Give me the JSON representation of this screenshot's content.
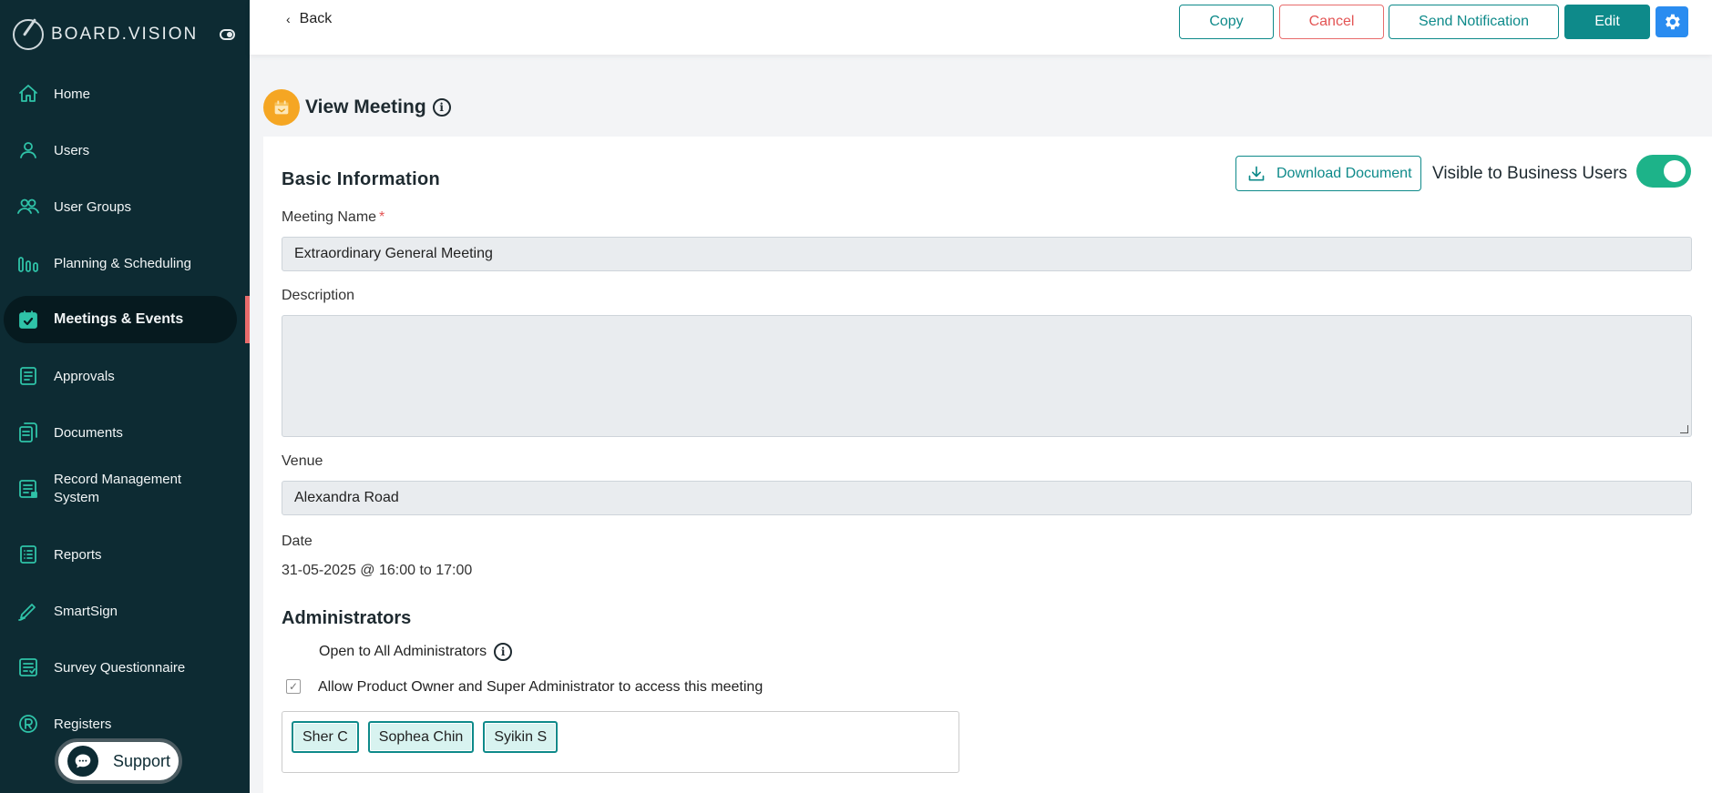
{
  "app": {
    "logo_text": "BOARD.VISION"
  },
  "sidebar": {
    "items": [
      {
        "label": "Home",
        "icon": "home-icon"
      },
      {
        "label": "Users",
        "icon": "user-icon"
      },
      {
        "label": "User Groups",
        "icon": "users-icon"
      },
      {
        "label": "Planning & Scheduling",
        "icon": "bars-icon"
      },
      {
        "label": "Meetings & Events",
        "icon": "calendar-check-icon",
        "active": true
      },
      {
        "label": "Approvals",
        "icon": "document-list-icon"
      },
      {
        "label": "Documents",
        "icon": "documents-icon"
      },
      {
        "label": "Record Management System",
        "icon": "record-icon"
      },
      {
        "label": "Reports",
        "icon": "report-icon"
      },
      {
        "label": "SmartSign",
        "icon": "pen-icon"
      },
      {
        "label": "Survey Questionnaire",
        "icon": "survey-icon"
      },
      {
        "label": "Registers",
        "icon": "registered-icon"
      }
    ],
    "support_label": "Support"
  },
  "header": {
    "back_label": "Back",
    "copy_label": "Copy",
    "cancel_label": "Cancel",
    "notify_label": "Send Notification",
    "edit_label": "Edit"
  },
  "page": {
    "title": "View Meeting"
  },
  "basic": {
    "section_title": "Basic Information",
    "download_label": "Download Document",
    "visible_label": "Visible to Business Users",
    "visible_on": true,
    "meeting_name_label": "Meeting Name",
    "meeting_name_required": "*",
    "meeting_name_value": "Extraordinary General Meeting",
    "description_label": "Description",
    "description_value": "",
    "venue_label": "Venue",
    "venue_value": "Alexandra Road",
    "date_label": "Date",
    "date_value": "31-05-2025 @ 16:00 to 17:00"
  },
  "administrators": {
    "title": "Administrators",
    "open_all_label": "Open to All Administrators",
    "allow_label": "Allow Product Owner and Super Administrator to access this meeting",
    "chips": [
      "Sher C",
      "Sophea Chin",
      "Syikin S"
    ]
  },
  "colors": {
    "sidebar_bg": "#0d2b33",
    "accent_teal": "#0e8a8a",
    "cancel_red": "#e35454",
    "gear_blue": "#2a8cf0",
    "toggle_green": "#1db389"
  }
}
